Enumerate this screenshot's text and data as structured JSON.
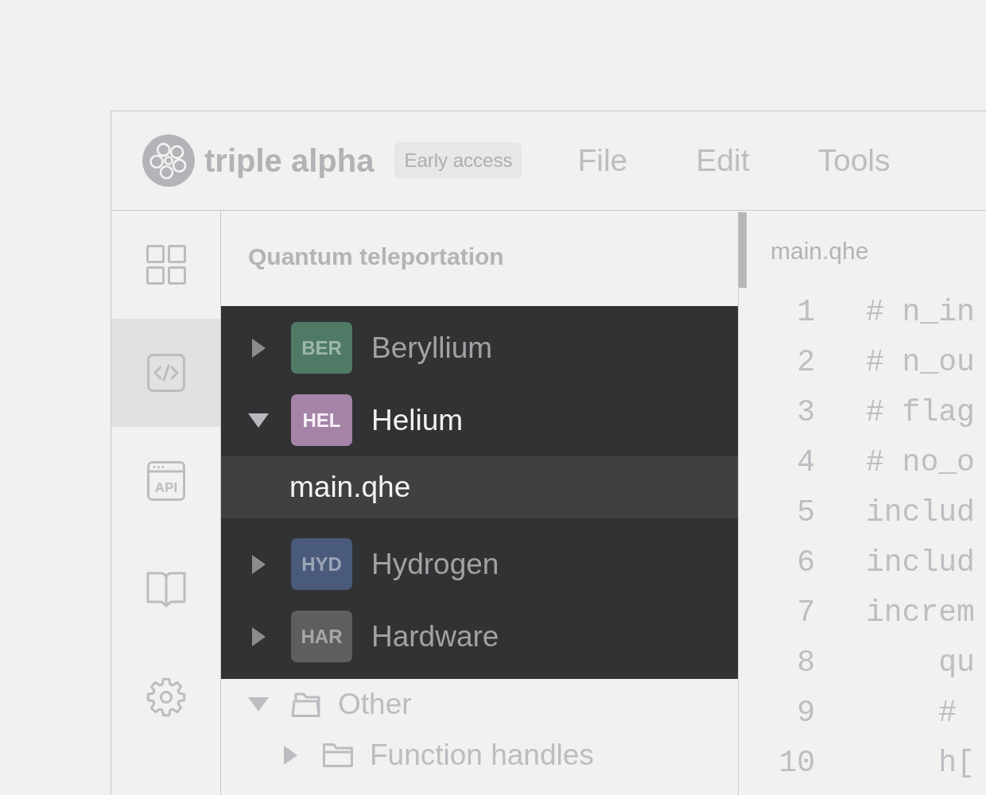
{
  "header": {
    "logo_text": "triple alpha",
    "badge": "Early access",
    "menu": [
      "File",
      "Edit",
      "Tools"
    ]
  },
  "sidebar": {
    "items": [
      {
        "kind": "grid",
        "selected": false
      },
      {
        "kind": "code",
        "selected": true
      },
      {
        "kind": "api",
        "label": "API",
        "selected": false
      },
      {
        "kind": "book",
        "selected": false
      },
      {
        "kind": "settings",
        "selected": false
      }
    ]
  },
  "explorer": {
    "title": "Quantum teleportation",
    "projects": [
      {
        "badge": "BER",
        "name": "Beryllium",
        "color": "#4f7a66",
        "expanded": false
      },
      {
        "badge": "HEL",
        "name": "Helium",
        "color": "#a584a8",
        "expanded": true,
        "children": [
          {
            "name": "main.qhe",
            "selected": true
          }
        ]
      },
      {
        "badge": "HYD",
        "name": "Hydrogen",
        "color": "#4a5a7a",
        "expanded": false
      },
      {
        "badge": "HAR",
        "name": "Hardware",
        "color": "#5e5e60",
        "expanded": false
      }
    ],
    "folders": [
      {
        "name": "Other",
        "expanded": true,
        "children": [
          {
            "name": "Function handles",
            "expanded": false
          }
        ]
      }
    ]
  },
  "editor": {
    "tab": "main.qhe",
    "lines": [
      {
        "number": "1",
        "code": "# n_in"
      },
      {
        "number": "2",
        "code": "# n_ou"
      },
      {
        "number": "3",
        "code": "# flag"
      },
      {
        "number": "4",
        "code": "# no_o"
      },
      {
        "number": "5",
        "code": "includ"
      },
      {
        "number": "6",
        "code": "includ"
      },
      {
        "number": "7",
        "code": "increm"
      },
      {
        "number": "8",
        "code": "    qu"
      },
      {
        "number": "9",
        "code": "    #"
      },
      {
        "number": "10",
        "code": "    h["
      }
    ]
  }
}
